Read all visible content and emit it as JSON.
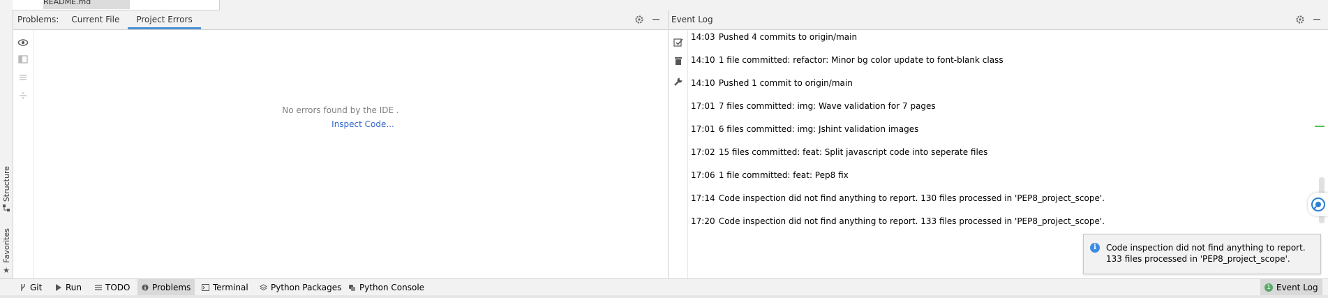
{
  "top_tree": {
    "item_label": "README.md"
  },
  "left_stripe": {
    "structure_label": "Structure",
    "favorites_label": "Favorites"
  },
  "problems": {
    "title": "Problems:",
    "tabs": [
      "Current File",
      "Project Errors"
    ],
    "active_tab": "Project Errors",
    "empty_text": "No errors found by the IDE .",
    "inspect_link": "Inspect Code..."
  },
  "event_log": {
    "title": "Event Log",
    "entries": [
      {
        "time": "14:03",
        "message": "Pushed 4 commits to origin/main"
      },
      {
        "time": "14:10",
        "message": "1 file committed: refactor: Minor bg color update to font-blank class"
      },
      {
        "time": "14:10",
        "message": "Pushed 1 commit to origin/main"
      },
      {
        "time": "17:01",
        "message": "7 files committed: img: Wave validation for 7 pages"
      },
      {
        "time": "17:01",
        "message": "6 files committed: img: Jshint validation images"
      },
      {
        "time": "17:02",
        "message": "15 files committed: feat: Split javascript code into seperate files"
      },
      {
        "time": "17:06",
        "message": "1 file committed: feat: Pep8 fix"
      },
      {
        "time": "17:14",
        "message": "Code inspection did not find anything to report. 130 files processed in 'PEP8_project_scope'."
      },
      {
        "time": "17:20",
        "message": "Code inspection did not find anything to report. 133 files processed in 'PEP8_project_scope'."
      }
    ]
  },
  "notification": {
    "line1": "Code inspection did not find anything to report.",
    "line2": "133 files processed in 'PEP8_project_scope'."
  },
  "bottom_bar": {
    "tabs": [
      {
        "label": "Git",
        "icon": "git-branch-icon"
      },
      {
        "label": "Run",
        "icon": "run-icon"
      },
      {
        "label": "TODO",
        "icon": "list-icon"
      },
      {
        "label": "Problems",
        "icon": "info-icon",
        "active": true
      },
      {
        "label": "Terminal",
        "icon": "terminal-icon"
      },
      {
        "label": "Python Packages",
        "icon": "layers-icon"
      },
      {
        "label": "Python Console",
        "icon": "python-icon"
      }
    ],
    "event_log_label": "Event Log",
    "event_log_count": "1"
  },
  "colors": {
    "accent": "#4a8fd6",
    "link": "#2f65ca",
    "info": "#3d8ce3",
    "success": "#59a869"
  }
}
